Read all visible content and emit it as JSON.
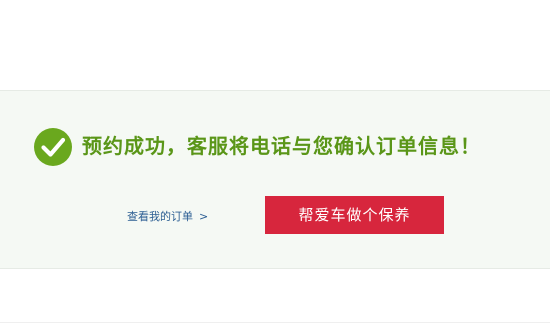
{
  "confirmation": {
    "message": "预约成功，客服将电话与您确认订单信息！",
    "view_orders_label": "查看我的订单",
    "view_orders_arrow": ">",
    "maintain_button_label": "帮爱车做个保养"
  },
  "colors": {
    "success_green": "#6aa81e",
    "message_green": "#5a9618",
    "button_red": "#d7263d",
    "link_blue": "#2c5e93",
    "panel_background": "#f5f9f4"
  },
  "icons": {
    "success": "check-circle-icon"
  }
}
